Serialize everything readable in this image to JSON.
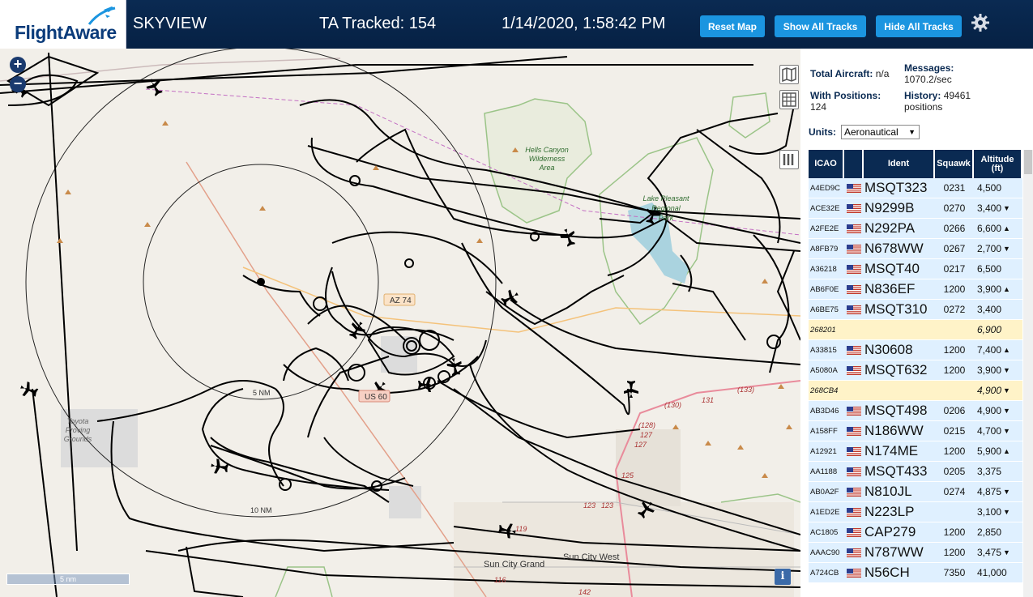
{
  "header": {
    "logo_text": "FlightAware",
    "title": "SKYVIEW",
    "tracked": "TA Tracked: 154",
    "datetime": "1/14/2020, 1:58:42 PM",
    "buttons": {
      "reset": "Reset Map",
      "show": "Show All Tracks",
      "hide": "Hide All Tracks"
    }
  },
  "map": {
    "zoom_in": "+",
    "zoom_out": "−",
    "scale_bar": "5 nm",
    "info": "i",
    "labels": {
      "ring_5nm": "5 NM",
      "ring_10nm": "10 NM",
      "hells_canyon_1": "Hells Canyon",
      "hells_canyon_2": "Wilderness",
      "hells_canyon_3": "Area",
      "lake_pleasant_1": "Lake Pleasant",
      "lake_pleasant_2": "Regional",
      "lake_pleasant_3": "Park",
      "toyota_1": "Toyota",
      "toyota_2": "Proving",
      "toyota_3": "Grounds",
      "sun_city_grand": "Sun City Grand",
      "sun_city_west": "Sun City West",
      "az74": "AZ 74",
      "us60": "US 60",
      "r130": "(130)",
      "r131": "131",
      "r133": "(133)",
      "r128": "(128)",
      "r127a": "127",
      "r127b": "127",
      "r125": "125",
      "r123a": "123",
      "r123b": "123",
      "r119": "119",
      "r116": "116",
      "r142": "142"
    }
  },
  "sidebar": {
    "total_label": "Total Aircraft:",
    "total_value": "n/a",
    "messages_label": "Messages:",
    "messages_value": "1070.2/sec",
    "positions_label": "With Positions:",
    "positions_value": "124",
    "history_label": "History:",
    "history_value": "49461",
    "history_unit": "positions",
    "units_label": "Units:",
    "units_value": "Aeronautical",
    "columns": {
      "icao": "ICAO",
      "ident": "Ident",
      "squawk": "Squawk",
      "altitude": "Altitude (ft)"
    },
    "rows": [
      {
        "icao": "A4ED9C",
        "ident": "MSQT323",
        "squawk": "0231",
        "alt": "4,500",
        "trend": "",
        "flag": true
      },
      {
        "icao": "ACE32E",
        "ident": "N9299B",
        "squawk": "0270",
        "alt": "3,400",
        "trend": "▼",
        "flag": true
      },
      {
        "icao": "A2FE2E",
        "ident": "N292PA",
        "squawk": "0266",
        "alt": "6,600",
        "trend": "▲",
        "flag": true
      },
      {
        "icao": "A8FB79",
        "ident": "N678WW",
        "squawk": "0267",
        "alt": "2,700",
        "trend": "▼",
        "flag": true
      },
      {
        "icao": "A36218",
        "ident": "MSQT40",
        "squawk": "0217",
        "alt": "6,500",
        "trend": "",
        "flag": true
      },
      {
        "icao": "AB6F0E",
        "ident": "N836EF",
        "squawk": "1200",
        "alt": "3,900",
        "trend": "▲",
        "flag": true
      },
      {
        "icao": "A6BE75",
        "ident": "MSQT310",
        "squawk": "0272",
        "alt": "3,400",
        "trend": "",
        "flag": true
      },
      {
        "icao": "268201",
        "ident": "",
        "squawk": "",
        "alt": "6,900",
        "trend": "",
        "flag": false
      },
      {
        "icao": "A33815",
        "ident": "N30608",
        "squawk": "1200",
        "alt": "7,400",
        "trend": "▲",
        "flag": true
      },
      {
        "icao": "A5080A",
        "ident": "MSQT632",
        "squawk": "1200",
        "alt": "3,900",
        "trend": "▼",
        "flag": true
      },
      {
        "icao": "268CB4",
        "ident": "",
        "squawk": "",
        "alt": "4,900",
        "trend": "▼",
        "flag": false
      },
      {
        "icao": "AB3D46",
        "ident": "MSQT498",
        "squawk": "0206",
        "alt": "4,900",
        "trend": "▼",
        "flag": true
      },
      {
        "icao": "A158FF",
        "ident": "N186WW",
        "squawk": "0215",
        "alt": "4,700",
        "trend": "▼",
        "flag": true
      },
      {
        "icao": "A12921",
        "ident": "N174ME",
        "squawk": "1200",
        "alt": "5,900",
        "trend": "▲",
        "flag": true
      },
      {
        "icao": "AA1188",
        "ident": "MSQT433",
        "squawk": "0205",
        "alt": "3,375",
        "trend": "",
        "flag": true
      },
      {
        "icao": "AB0A2F",
        "ident": "N810JL",
        "squawk": "0274",
        "alt": "4,875",
        "trend": "▼",
        "flag": true
      },
      {
        "icao": "A1ED2E",
        "ident": "N223LP",
        "squawk": "",
        "alt": "3,100",
        "trend": "▼",
        "flag": true
      },
      {
        "icao": "AC1805",
        "ident": "CAP279",
        "squawk": "1200",
        "alt": "2,850",
        "trend": "",
        "flag": true
      },
      {
        "icao": "AAAC90",
        "ident": "N787WW",
        "squawk": "1200",
        "alt": "3,475",
        "trend": "▼",
        "flag": true
      },
      {
        "icao": "A724CB",
        "ident": "N56CH",
        "squawk": "7350",
        "alt": "41,000",
        "trend": "",
        "flag": true
      }
    ]
  },
  "colors": {
    "header_bg": "#062144",
    "button_bg": "#1b95e0",
    "row_bg": "#dff0ff",
    "row_noident_bg": "#fff3c8",
    "table_header_bg": "#0a2a52",
    "map_bg": "#f2efe9",
    "track": "#000000"
  }
}
